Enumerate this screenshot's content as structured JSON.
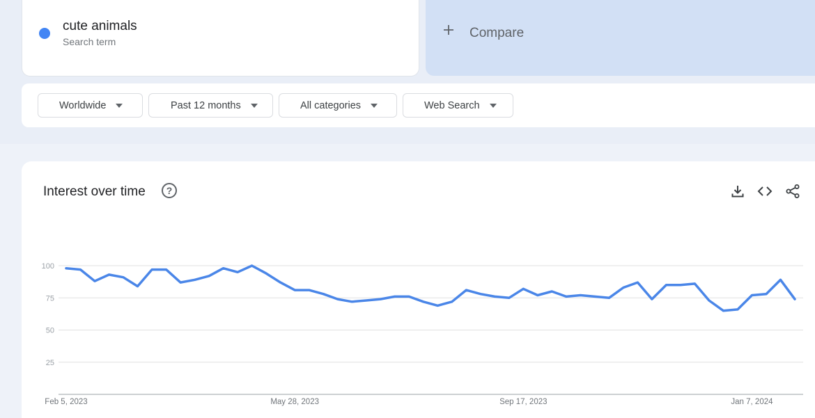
{
  "search_term": {
    "name": "cute animals",
    "subtitle": "Search term",
    "color": "#4285f4"
  },
  "compare": {
    "label": "Compare",
    "icon": "plus-icon"
  },
  "filters": [
    {
      "label": "Worldwide",
      "icon": "caret-down-icon"
    },
    {
      "label": "Past 12 months",
      "icon": "caret-down-icon"
    },
    {
      "label": "All categories",
      "icon": "caret-down-icon"
    },
    {
      "label": "Web Search",
      "icon": "caret-down-icon"
    }
  ],
  "chart_section": {
    "title": "Interest over time",
    "help_icon": "help-circle-icon",
    "help_glyph": "?",
    "actions": [
      "download-icon",
      "embed-code-icon",
      "share-icon"
    ]
  },
  "chart_data": {
    "type": "line",
    "title": "",
    "xlabel": "",
    "ylabel": "",
    "ylim": [
      0,
      100
    ],
    "yticks": [
      25,
      50,
      75,
      100
    ],
    "grid": true,
    "x_tick_labels": [
      {
        "label": "Feb 5, 2023",
        "index": 0
      },
      {
        "label": "May 28, 2023",
        "index": 16
      },
      {
        "label": "Sep 17, 2023",
        "index": 32
      },
      {
        "label": "Jan 7, 2024",
        "index": 48
      }
    ],
    "series": [
      {
        "color": "#4a86e8",
        "values": [
          98,
          97,
          88,
          93,
          91,
          84,
          97,
          97,
          87,
          89,
          92,
          98,
          95,
          100,
          94,
          87,
          81,
          81,
          78,
          74,
          72,
          73,
          74,
          76,
          76,
          72,
          69,
          72,
          81,
          78,
          76,
          75,
          82,
          77,
          80,
          76,
          77,
          76,
          75,
          83,
          87,
          74,
          85,
          85,
          86,
          73,
          65,
          66,
          77,
          78,
          89,
          74
        ]
      }
    ]
  }
}
